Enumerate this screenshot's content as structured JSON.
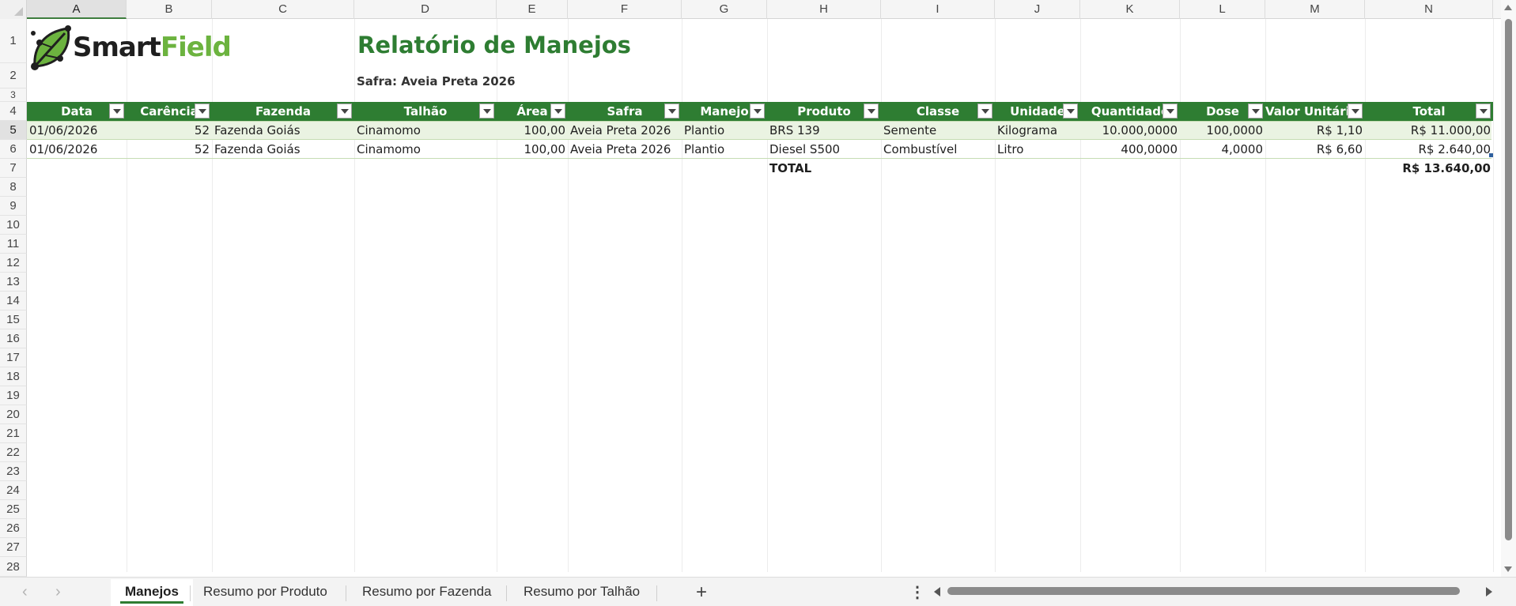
{
  "columns": [
    "A",
    "B",
    "C",
    "D",
    "E",
    "F",
    "G",
    "H",
    "I",
    "J",
    "K",
    "L",
    "M",
    "N"
  ],
  "rows": [
    "1",
    "2",
    "3",
    "4",
    "5",
    "6",
    "7",
    "8",
    "9",
    "10",
    "11",
    "12",
    "13",
    "14",
    "15",
    "16",
    "17",
    "18",
    "19",
    "20",
    "21",
    "22",
    "23",
    "24",
    "25",
    "26",
    "27",
    "28"
  ],
  "logo": {
    "part1": "Smart",
    "part2": "Field",
    "colors": {
      "dark": "#1f1f1f",
      "green": "#6cb33f"
    }
  },
  "report": {
    "title": "Relatório de Manejos",
    "subtitle": "Safra: Aveia Preta 2026"
  },
  "table": {
    "headers": [
      "Data",
      "Carência",
      "Fazenda",
      "Talhão",
      "Área",
      "Safra",
      "Manejo",
      "Produto",
      "Classe",
      "Unidade",
      "Quantidade",
      "Dose",
      "Valor Unitário",
      "Total"
    ],
    "rows": [
      [
        "01/06/2026",
        "52",
        "Fazenda Goiás",
        "Cinamomo",
        "100,00",
        "Aveia Preta 2026",
        "Plantio",
        "BRS 139",
        "Semente",
        "Kilograma",
        "10.000,0000",
        "100,0000",
        "R$ 1,10",
        "R$ 11.000,00"
      ],
      [
        "01/06/2026",
        "52",
        "Fazenda Goiás",
        "Cinamomo",
        "100,00",
        "Aveia Preta 2026",
        "Plantio",
        "Diesel S500",
        "Combustível",
        "Litro",
        "400,0000",
        "4,0000",
        "R$ 6,60",
        "R$ 2.640,00"
      ]
    ],
    "total_label": "TOTAL",
    "total_value": "R$ 13.640,00"
  },
  "sheet_tabs": [
    "Manejos",
    "Resumo por Produto",
    "Resumo por Fazenda",
    "Resumo por Talhão"
  ],
  "active_tab": "Manejos",
  "icons": {
    "prev": "chevron-left-icon",
    "next": "chevron-right-icon",
    "add": "plus-icon",
    "more": "more-vertical-icon"
  },
  "colors": {
    "header_green": "#2e7d32",
    "band": "#eaf3e2"
  }
}
